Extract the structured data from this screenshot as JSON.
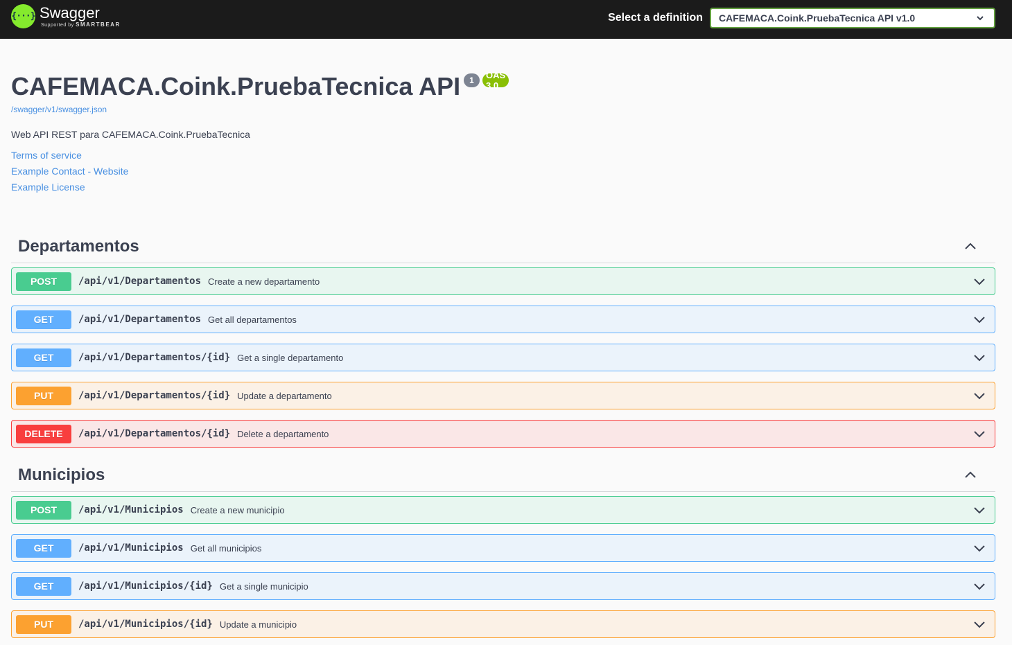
{
  "topbar": {
    "logo_mark": "{···}",
    "logo_name": "Swagger",
    "logo_sub_prefix": "Supported by",
    "logo_sub_brand": "SMARTBEAR",
    "select_label": "Select a definition",
    "selected_definition": "CAFEMACA.Coink.PruebaTecnica API v1.0"
  },
  "info": {
    "title": "CAFEMACA.Coink.PruebaTecnica API",
    "version_badge": "1",
    "oas_badge": "OAS 3.0",
    "spec_url": "/swagger/v1/swagger.json",
    "description": "Web API REST para CAFEMACA.Coink.PruebaTecnica",
    "links": [
      "Terms of service",
      "Example Contact - Website",
      "Example License"
    ]
  },
  "tags": [
    {
      "name": "Departamentos",
      "operations": [
        {
          "method": "POST",
          "path": "/api/v1/Departamentos",
          "summary": "Create a new departamento"
        },
        {
          "method": "GET",
          "path": "/api/v1/Departamentos",
          "summary": "Get all departamentos"
        },
        {
          "method": "GET",
          "path": "/api/v1/Departamentos/{id}",
          "summary": "Get a single departamento"
        },
        {
          "method": "PUT",
          "path": "/api/v1/Departamentos/{id}",
          "summary": "Update a departamento"
        },
        {
          "method": "DELETE",
          "path": "/api/v1/Departamentos/{id}",
          "summary": "Delete a departamento"
        }
      ]
    },
    {
      "name": "Municipios",
      "operations": [
        {
          "method": "POST",
          "path": "/api/v1/Municipios",
          "summary": "Create a new municipio"
        },
        {
          "method": "GET",
          "path": "/api/v1/Municipios",
          "summary": "Get all municipios"
        },
        {
          "method": "GET",
          "path": "/api/v1/Municipios/{id}",
          "summary": "Get a single municipio"
        },
        {
          "method": "PUT",
          "path": "/api/v1/Municipios/{id}",
          "summary": "Update a municipio"
        }
      ]
    }
  ],
  "colors": {
    "post": "#49cc90",
    "get": "#61affe",
    "put": "#fca130",
    "delete": "#f93e3e",
    "swagger_green": "#85ea2d",
    "oas_badge": "#89bf04"
  },
  "icons": {
    "tag_collapse": "chevron-up-icon",
    "op_expand": "chevron-down-icon",
    "select_dropdown": "chevron-down-icon"
  }
}
